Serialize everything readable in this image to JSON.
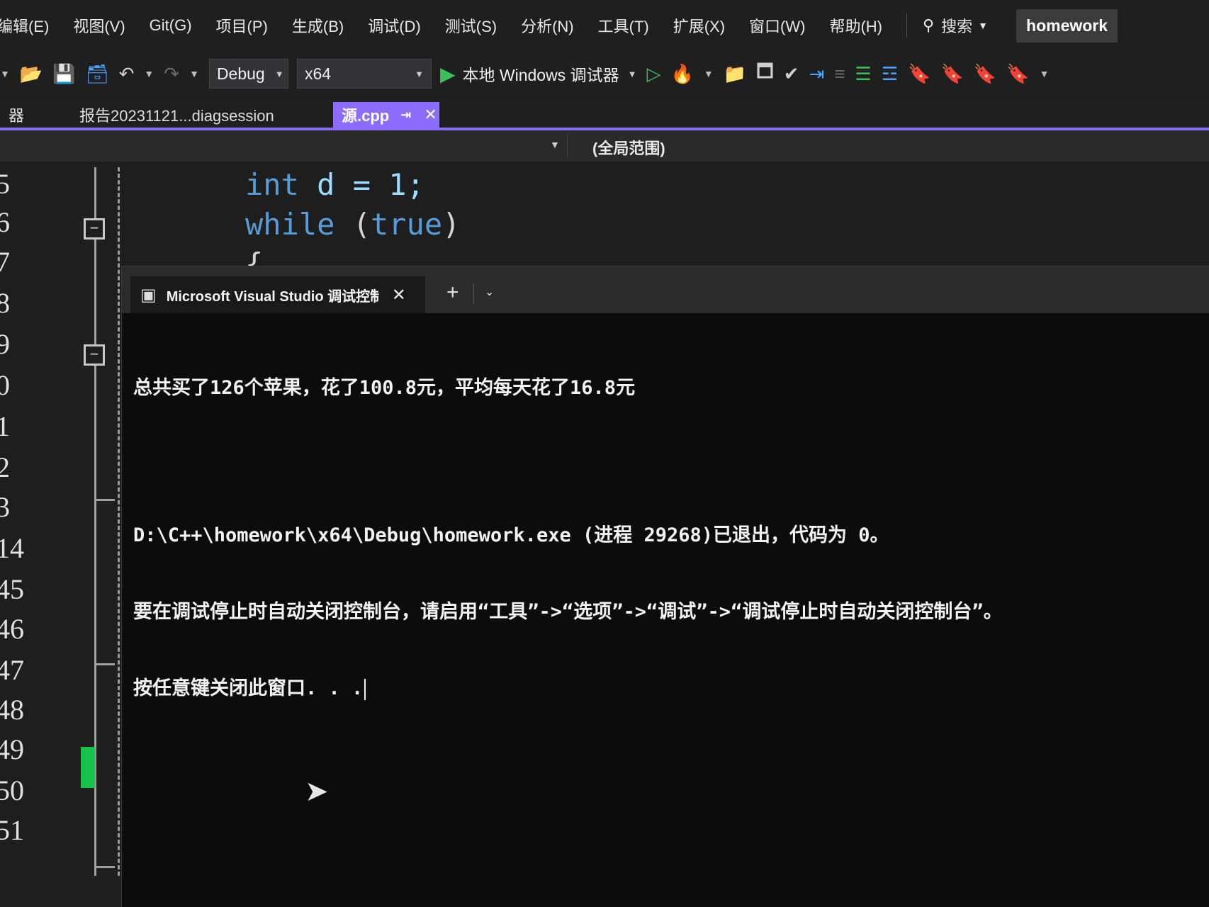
{
  "menu": {
    "items": [
      "编辑(E)",
      "视图(V)",
      "Git(G)",
      "项目(P)",
      "生成(B)",
      "调试(D)",
      "测试(S)",
      "分析(N)",
      "工具(T)",
      "扩展(X)",
      "窗口(W)",
      "帮助(H)"
    ],
    "search_label": "搜索",
    "solution_name": "homework"
  },
  "toolbar": {
    "config": "Debug",
    "platform": "x64",
    "debugger_label": "本地 Windows 调试器"
  },
  "tabs": [
    {
      "label": "器"
    },
    {
      "label": "报告20231121...diagsession"
    },
    {
      "label": "源.cpp",
      "active": true
    }
  ],
  "navbar": {
    "scope": "(全局范围)"
  },
  "editor": {
    "line_numbers": [
      "5",
      "6",
      "7",
      "8",
      "9",
      "0",
      "1",
      "2",
      "3",
      "14",
      "45",
      "46",
      "47",
      "48",
      "49",
      "50",
      "51"
    ],
    "code_lines": {
      "line1": {
        "kw": "int",
        "rest": " d = 1;"
      },
      "line2": {
        "kw": "while",
        "rest": " (",
        "kw2": "true",
        "end": ")"
      },
      "line3": "{"
    }
  },
  "console": {
    "tab_title": "Microsoft Visual Studio 调试控制台",
    "output_line1": "总共买了126个苹果，花了100.8元，平均每天花了16.8元",
    "output_line2": "D:\\C++\\homework\\x64\\Debug\\homework.exe (进程 29268)已退出，代码为 0。",
    "output_line3": "要在调试停止时自动关闭控制台，请启用“工具”->“选项”->“调试”->“调试停止时自动关闭控制台”。",
    "output_line4": "按任意键关闭此窗口. . ."
  },
  "colors": {
    "accent_tab": "#8c6cff",
    "change_bar": "#16c24a",
    "console_bg": "#0c0c0c"
  }
}
